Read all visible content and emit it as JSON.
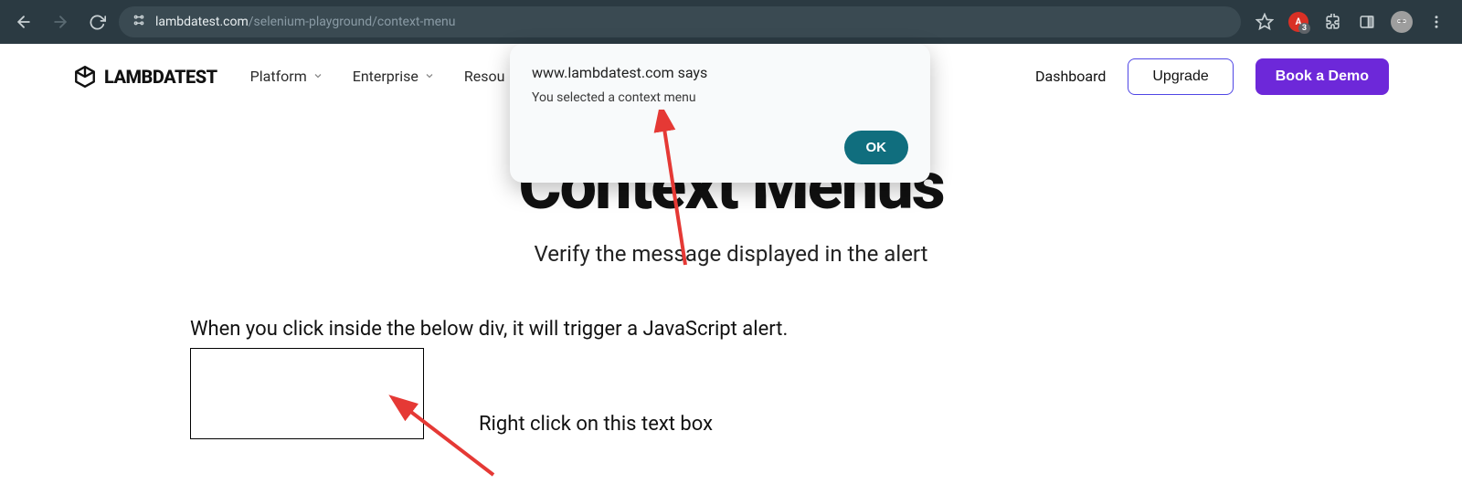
{
  "browser": {
    "url_domain": "lambdatest.com",
    "url_path": "/selenium-playground/context-menu",
    "ext_badge_count": "3"
  },
  "header": {
    "brand": "LAMBDATEST",
    "nav": {
      "platform": "Platform",
      "enterprise": "Enterprise",
      "resources": "Resou"
    },
    "dashboard": "Dashboard",
    "upgrade": "Upgrade",
    "book_demo": "Book a Demo"
  },
  "page": {
    "title": "Context Menus",
    "subtitle": "Verify the message displayed in the alert",
    "instruction": "When you click inside the below div, it will trigger a JavaScript alert.",
    "box_label": "Right click on this text box"
  },
  "alert": {
    "origin": "www.lambdatest.com says",
    "message": "You selected a context menu",
    "ok": "OK"
  }
}
